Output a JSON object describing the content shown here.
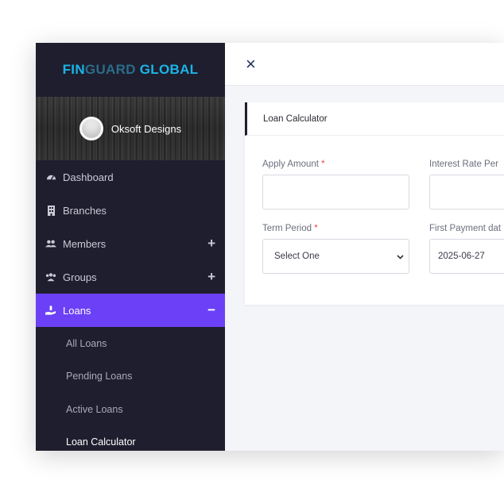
{
  "brand": {
    "part1": "FIN",
    "part2": "GUARD",
    "part3": " GLOBAL"
  },
  "user": {
    "name": "Oksoft Designs"
  },
  "sidebar": {
    "items": [
      {
        "label": "Dashboard"
      },
      {
        "label": "Branches"
      },
      {
        "label": "Members",
        "toggle": "+"
      },
      {
        "label": "Groups",
        "toggle": "+"
      },
      {
        "label": "Loans",
        "toggle": "−"
      }
    ],
    "loan_subitems": [
      {
        "label": "All Loans"
      },
      {
        "label": "Pending Loans"
      },
      {
        "label": "Active Loans"
      },
      {
        "label": "Loan Calculator"
      }
    ]
  },
  "topbar": {
    "close_glyph": "×"
  },
  "card": {
    "title": "Loan Calculator",
    "fields": {
      "apply_amount": {
        "label": "Apply Amount",
        "required": "*",
        "value": ""
      },
      "interest_rate": {
        "label": "Interest Rate Per",
        "value": ""
      },
      "term_period": {
        "label": "Term Period",
        "required": "*",
        "value": "Select One"
      },
      "first_payment": {
        "label": "First Payment dat",
        "value": "2025-06-27"
      }
    }
  },
  "colors": {
    "sidebar_bg": "#1f1e2e",
    "accent": "#6c40f6",
    "brand_cyan": "#1ab5e8",
    "required": "#e54949"
  }
}
